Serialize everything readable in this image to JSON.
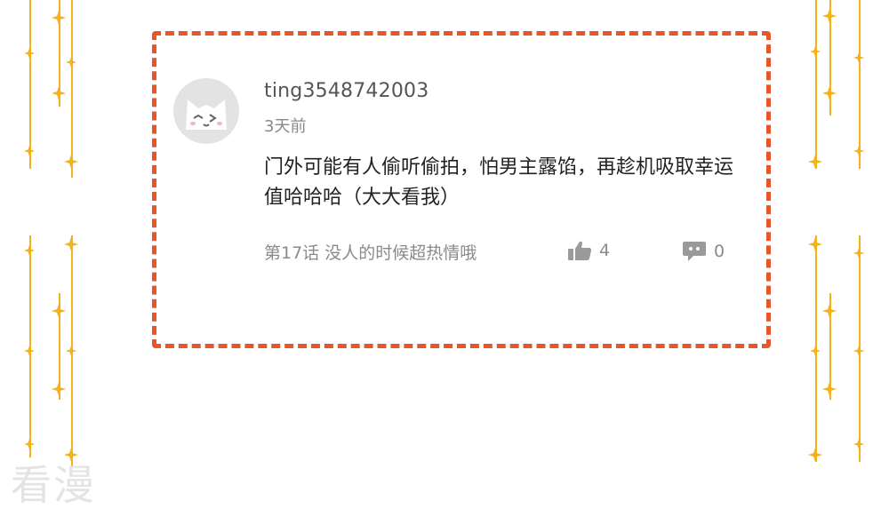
{
  "comment": {
    "username": "ting3548742003",
    "time": "3天前",
    "text": "门外可能有人偷听偷拍，怕男主露馅，再趁机吸取幸运值哈哈哈（大大看我）",
    "chapter": "第17话 没人的时候超热情哦",
    "likes": "4",
    "replies": "0"
  },
  "watermark": "看漫",
  "colors": {
    "frame": "#e9552a",
    "decoration": "#f2b21c",
    "meta_text": "#8a8a8a"
  },
  "icons": [
    "cat-avatar-icon",
    "thumbs-up-icon",
    "comment-bubble-icon",
    "sparkle-star-icon"
  ]
}
